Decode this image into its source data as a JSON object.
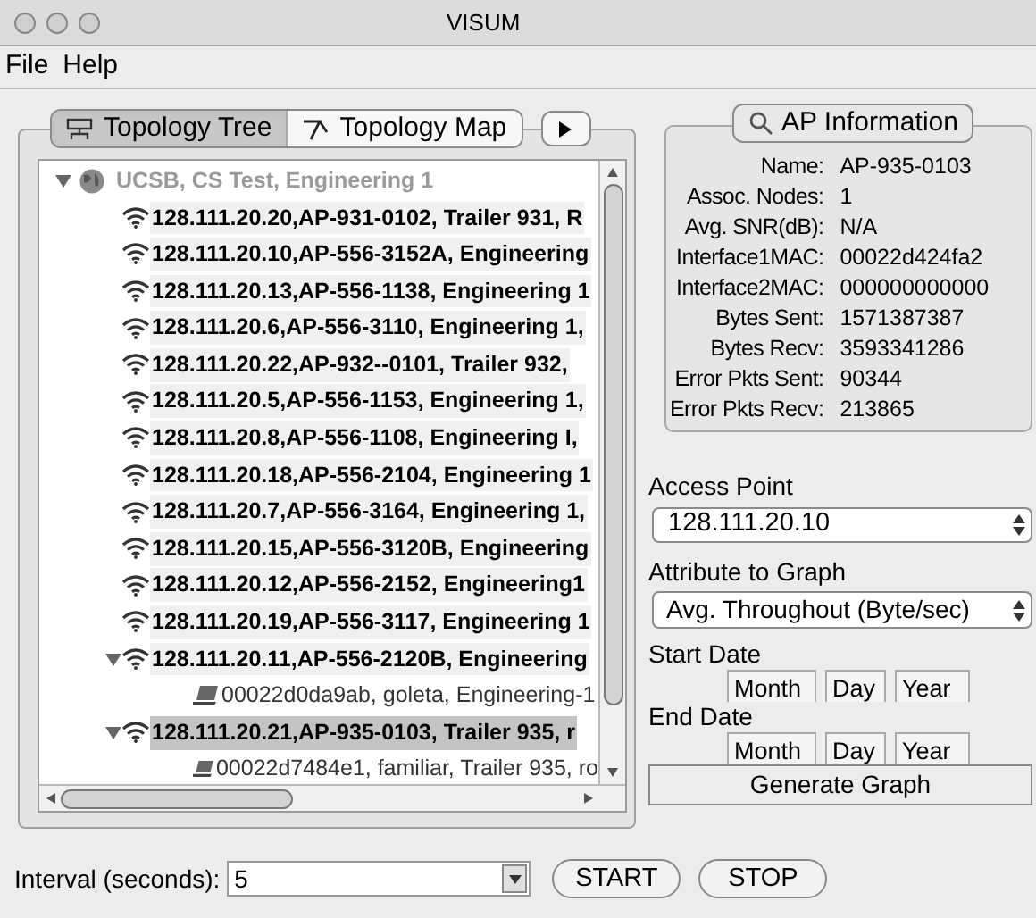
{
  "window": {
    "title": "VISUM"
  },
  "menu": [
    "File",
    "Help"
  ],
  "tabs": [
    {
      "label": "Topology Tree",
      "kind": "tree",
      "selected": true
    },
    {
      "label": "Topology Map",
      "kind": "map",
      "selected": false
    }
  ],
  "tree": {
    "label": "UCSB, CS Test, Engineering 1",
    "expanded": true,
    "children": [
      {
        "label": "128.111.20.20,AP-931-0102, Trailer 931, R",
        "selected": false
      },
      {
        "label": "128.111.20.10,AP-556-3152A, Engineering",
        "selected": false
      },
      {
        "label": "128.111.20.13,AP-556-1138, Engineering 1",
        "selected": false
      },
      {
        "label": "128.111.20.6,AP-556-3110, Engineering 1,",
        "selected": false
      },
      {
        "label": "128.111.20.22,AP-932--0101, Trailer 932,",
        "selected": false
      },
      {
        "label": "128.111.20.5,AP-556-1153, Engineering 1,",
        "selected": false
      },
      {
        "label": "128.111.20.8,AP-556-1108, Engineering I,",
        "selected": false
      },
      {
        "label": "128.111.20.18,AP-556-2104, Engineering 1",
        "selected": false
      },
      {
        "label": "128.111.20.7,AP-556-3164, Engineering 1,",
        "selected": false
      },
      {
        "label": "128.111.20.15,AP-556-3120B, Engineering",
        "selected": false
      },
      {
        "label": "128.111.20.12,AP-556-2152, Engineering1",
        "selected": false
      },
      {
        "label": "128.111.20.19,AP-556-3117, Engineering 1",
        "selected": false
      },
      {
        "label": "128.111.20.11,AP-556-2120B, Engineering",
        "selected": false,
        "expanded": true,
        "children": [
          {
            "label": "00022d0da9ab, goleta, Engineering-1"
          }
        ]
      },
      {
        "label": "128.111.20.21,AP-935-0103, Trailer 935, r",
        "selected": true,
        "expanded": true,
        "children": [
          {
            "label": "00022d7484e1, familiar, Trailer 935, ro"
          }
        ]
      }
    ]
  },
  "ap_info": {
    "button": "AP Information",
    "fields": [
      {
        "label": "Name:",
        "value": "AP-935-0103"
      },
      {
        "label": "Assoc. Nodes:",
        "value": "1"
      },
      {
        "label": "Avg. SNR(dB):",
        "value": "N/A"
      },
      {
        "label": "Interface1MAC:",
        "value": "00022d424fa2"
      },
      {
        "label": "Interface2MAC:",
        "value": "000000000000"
      },
      {
        "label": "Bytes Sent:",
        "value": "1571387387"
      },
      {
        "label": "Bytes Recv:",
        "value": "3593341286"
      },
      {
        "label": "Error Pkts Sent:",
        "value": "90344"
      },
      {
        "label": "Error Pkts Recv:",
        "value": "213865"
      }
    ]
  },
  "graph_form": {
    "access_point_label": "Access Point",
    "access_point": "128.111.20.10",
    "attribute_label": "Attribute to Graph",
    "attribute": "Avg. Throughout (Byte/sec)",
    "start_date_label": "Start Date",
    "start_date": [
      {
        "placeholder": "Month"
      },
      {
        "placeholder": "Day"
      },
      {
        "placeholder": "Year"
      }
    ],
    "end_date_label": "End Date",
    "end_date": [
      {
        "placeholder": "Month"
      },
      {
        "placeholder": "Day"
      },
      {
        "placeholder": "Year"
      }
    ],
    "generate_button": "Generate Graph"
  },
  "bottom_bar": {
    "interval_label": "Interval (seconds):",
    "interval": "5",
    "start_button": "START",
    "stop_button": "STOP"
  }
}
